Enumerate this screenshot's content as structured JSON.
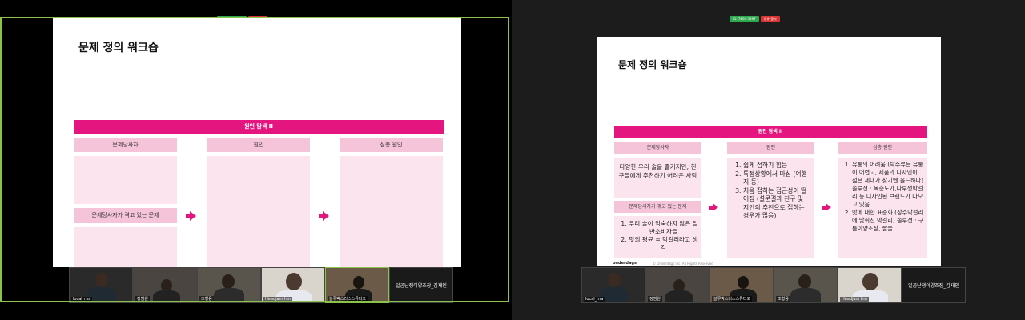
{
  "share_controls": {
    "meeting_info": "ID: 7864-5897",
    "stop_label": "공유 중지"
  },
  "slide": {
    "title": "문제 정의 워크숍",
    "section_bar": "원인 탐색 II",
    "columns": [
      "문제당사자",
      "원인",
      "심층 원인"
    ],
    "problem_label": "문제당사자가 겪고 있는 문제",
    "footer_logo": "onderdags",
    "footer_copyright": "© Onderdags Inc. All Rights Reserved"
  },
  "right_slide_content": {
    "persona": "다양한 우리 술을 즐기지만, 친구들에게 추천하기 어려운 사람",
    "problems": [
      "우리 술이 익숙하지 않은 일반소비자들",
      "맛의 평균 = 막걸리라고 생각"
    ],
    "causes": [
      "쉽게 접하기 힘듬",
      "특정상황에서 마심 (여행지 등)",
      "처음 접하는 접근성이 떨어짐 (설문결과 친구 및 지인의 추천으로 접하는 경우가 많음)"
    ],
    "deep_causes": [
      "유통의 어려움 (탁주류는 유통이 어렵고, 제품의 디자인이 젊은 세대가 찾기엔 올드하다) 솔루션 : 복순도가,나루생막걸리 등 디자인된 브랜드가 나오고 있음.",
      "맛에 대한 표준화 (장수막걸리에 맞춰진 막걸리) 솔루션 : 구름이양조장, 쌀술"
    ]
  },
  "participants_left": [
    {
      "label": "local_rna"
    },
    {
      "label": "정범원"
    },
    {
      "label": "조형용"
    },
    {
      "label": "Headjam Inn"
    },
    {
      "label": "블루박스리스스튜디오"
    }
  ],
  "participants_right": [
    {
      "label": "local_rna"
    },
    {
      "label": "정범원"
    },
    {
      "label": "블루박스리스스튜디오"
    },
    {
      "label": "조형용"
    },
    {
      "label": "Headjam Inn"
    }
  ],
  "name_tile": "일곱난쟁이양조장_김재인",
  "colors": {
    "accent": "#e4157e",
    "header_pink": "#f6c4d8",
    "cell_pink": "#fce4ee",
    "focus": "#8bc34a"
  }
}
